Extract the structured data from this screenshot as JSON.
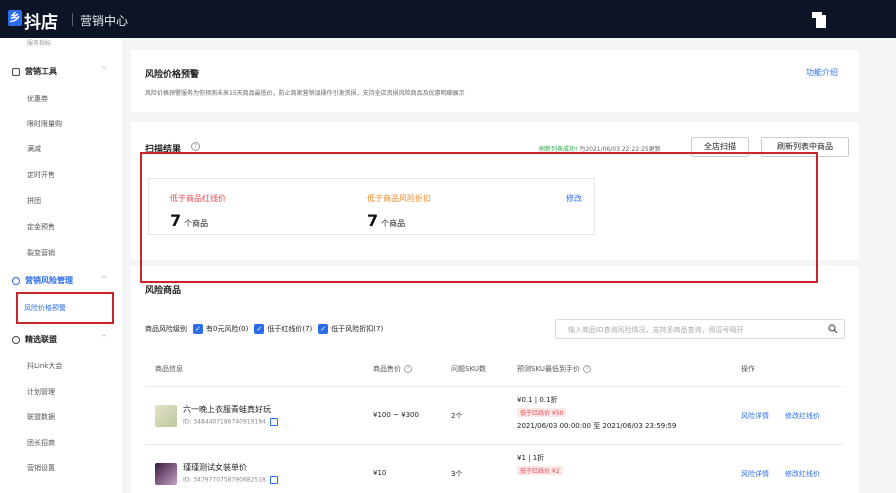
{
  "header": {
    "brand": "抖店",
    "subtitle": "营销中心"
  },
  "sidebar": {
    "top_item": "服务指标",
    "groups": [
      {
        "label": "营销工具",
        "items": [
          "优惠券",
          "限时限量购",
          "满减",
          "定时开售",
          "拼团",
          "定金预售",
          "裂变营销"
        ]
      },
      {
        "label": "营销风险管理",
        "items": [
          "风险价格预警"
        ]
      },
      {
        "label": "精选联盟",
        "items": [
          "抖Link大会",
          "计划管理",
          "联盟数据",
          "团长招商",
          "营销设置"
        ]
      }
    ],
    "active_item": "风险价格预警"
  },
  "intro": {
    "title": "风险价格预警",
    "description": "风险价格预警服务为你预测未来15天商品最低价，防止商家营销误操作引发资损，支持全店资损风险商品及优惠明细展示",
    "help_link": "功能介绍"
  },
  "scan": {
    "title": "扫描结果",
    "status_ok": "刷新列表成功!",
    "status_time": "为2021/06/03 22:22:25更新",
    "full_scan_button": "全店扫描",
    "refresh_button": "刷新列表中商品",
    "metrics": [
      {
        "label": "低于商品红线价",
        "value": "7",
        "unit": "个商品"
      },
      {
        "label": "低于商品风险折扣",
        "value": "7",
        "unit": "个商品"
      }
    ],
    "edit_link": "修改"
  },
  "risk": {
    "title": "风险商品",
    "filter_label": "商品风险级别",
    "filters": [
      "有0元风险(0)",
      "低于红线价(7)",
      "低于风险折扣(7)"
    ],
    "search_placeholder": "输入商品ID查询风险情况，支持多商品查询，用逗号隔开",
    "columns": [
      "商品信息",
      "商品售价",
      "问题SKU数",
      "预测SKU最低到手价",
      "操作"
    ],
    "rows": [
      {
        "name": "六一晚上衣服青蛙真好玩",
        "id": "ID: 3484407186740919194",
        "price": "¥100 ~ ¥300",
        "sku_count": "2个",
        "min_price": "¥0.1 | 0.1折",
        "tag": "低于红线价 ¥50",
        "period": "2021/06/03 00:00:00 至 2021/06/03 23:59:59",
        "action_detail": "风险详情",
        "action_edit": "修改红线价"
      },
      {
        "name": "瑾瑾测试女装单价",
        "id": "ID: 3479770758790682518",
        "price": "¥10",
        "sku_count": "3个",
        "min_price": "¥1 | 1折",
        "tag": "低于红线价 ¥2",
        "period": "",
        "action_detail": "风险详情",
        "action_edit": "修改红线价"
      }
    ]
  },
  "colors": {
    "accent": "#2b6de8",
    "danger": "#e5484d",
    "warning": "#f08a24",
    "highlight_box": "#c9252b",
    "topbar": "#0d1426"
  }
}
